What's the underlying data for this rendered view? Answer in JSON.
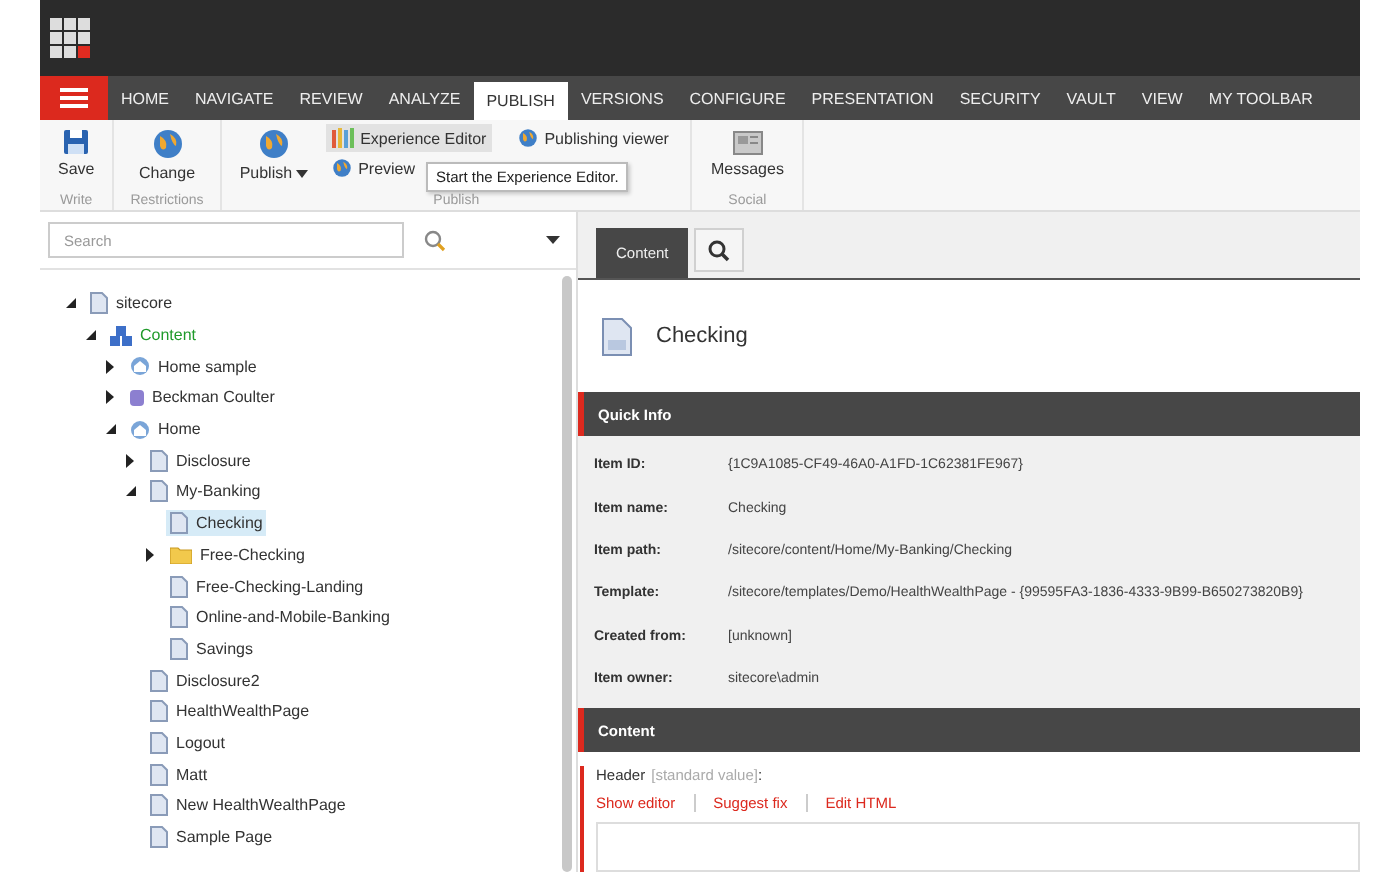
{
  "menu_tabs": [
    {
      "label": "HOME",
      "selected": false
    },
    {
      "label": "NAVIGATE",
      "selected": false
    },
    {
      "label": "REVIEW",
      "selected": false
    },
    {
      "label": "ANALYZE",
      "selected": false
    },
    {
      "label": "PUBLISH",
      "selected": true
    },
    {
      "label": "VERSIONS",
      "selected": false
    },
    {
      "label": "CONFIGURE",
      "selected": false
    },
    {
      "label": "PRESENTATION",
      "selected": false
    },
    {
      "label": "SECURITY",
      "selected": false
    },
    {
      "label": "VAULT",
      "selected": false
    },
    {
      "label": "VIEW",
      "selected": false
    },
    {
      "label": "MY TOOLBAR",
      "selected": false
    }
  ],
  "ribbon_groups": [
    {
      "label": "Write",
      "buttons": [
        {
          "kind": "save",
          "label": "Save"
        }
      ]
    },
    {
      "label": "Restrictions",
      "buttons": [
        {
          "kind": "change",
          "label": "Change"
        }
      ]
    },
    {
      "label": "Publish",
      "buttons": [
        {
          "kind": "publish",
          "label": "Publish",
          "dropdown": true
        },
        {
          "kind": "editor",
          "label": "Experience Editor",
          "hovered": true
        },
        {
          "kind": "preview",
          "label": "Preview",
          "hovered": false
        },
        {
          "kind": "viewer",
          "label": "Publishing viewer",
          "hovered": false
        }
      ]
    },
    {
      "label": "Social",
      "buttons": [
        {
          "kind": "messages",
          "label": "Messages"
        }
      ]
    }
  ],
  "tooltip": "Start the Experience Editor.",
  "search": {
    "placeholder": "Search"
  },
  "tree": [
    {
      "label": "sitecore",
      "kind": "page",
      "expanded": true,
      "selected": false,
      "children": [
        {
          "label": "Content",
          "kind": "content",
          "expanded": true,
          "selected": false,
          "children": [
            {
              "label": "Home sample",
              "kind": "home",
              "expanded": false,
              "selected": false
            },
            {
              "label": "Beckman Coulter",
              "kind": "db",
              "expanded": false,
              "selected": false
            },
            {
              "label": "Home",
              "kind": "home",
              "expanded": true,
              "selected": false,
              "children": [
                {
                  "label": "Disclosure",
                  "kind": "page",
                  "expanded": false,
                  "selected": false
                },
                {
                  "label": "My-Banking",
                  "kind": "page",
                  "expanded": true,
                  "selected": false,
                  "children": [
                    {
                      "label": "Checking",
                      "kind": "page",
                      "selected": true
                    },
                    {
                      "label": "Free-Checking",
                      "kind": "folder",
                      "expanded": false,
                      "selected": false
                    },
                    {
                      "label": "Free-Checking-Landing",
                      "kind": "page",
                      "selected": false
                    },
                    {
                      "label": "Online-and-Mobile-Banking",
                      "kind": "page",
                      "selected": false
                    },
                    {
                      "label": "Savings",
                      "kind": "page",
                      "selected": false
                    }
                  ]
                },
                {
                  "label": "Disclosure2",
                  "kind": "page",
                  "selected": false
                },
                {
                  "label": "HealthWealthPage",
                  "kind": "page",
                  "selected": false
                },
                {
                  "label": "Logout",
                  "kind": "page",
                  "selected": false
                },
                {
                  "label": "Matt",
                  "kind": "page",
                  "selected": false
                },
                {
                  "label": "New HealthWealthPage",
                  "kind": "page",
                  "selected": false
                },
                {
                  "label": "Sample Page",
                  "kind": "page",
                  "selected": false
                }
              ]
            }
          ]
        }
      ]
    }
  ],
  "editor_tabs": [
    {
      "kind": "text",
      "label": "Content",
      "selected": true
    },
    {
      "kind": "search",
      "selected": false
    }
  ],
  "item_title": "Checking",
  "quick_info": {
    "title": "Quick Info",
    "fields": [
      {
        "label": "Item ID:",
        "value": "{1C9A1085-CF49-46A0-A1FD-1C62381FE967}"
      },
      {
        "label": "Item name:",
        "value": "Checking"
      },
      {
        "label": "Item path:",
        "value": "/sitecore/content/Home/My-Banking/Checking"
      },
      {
        "label": "Template:",
        "value": "/sitecore/templates/Demo/HealthWealthPage - {99595FA3-1836-4333-9B99-B650273820B9}"
      },
      {
        "label": "Created from:",
        "value": "[unknown]"
      },
      {
        "label": "Item owner:",
        "value": "sitecore\\admin"
      }
    ]
  },
  "content_section": {
    "title": "Content",
    "field": {
      "label": "Header",
      "note": "[standard value]",
      "suffix": ":",
      "actions": [
        "Show editor",
        "Suggest fix",
        "Edit HTML"
      ]
    }
  }
}
